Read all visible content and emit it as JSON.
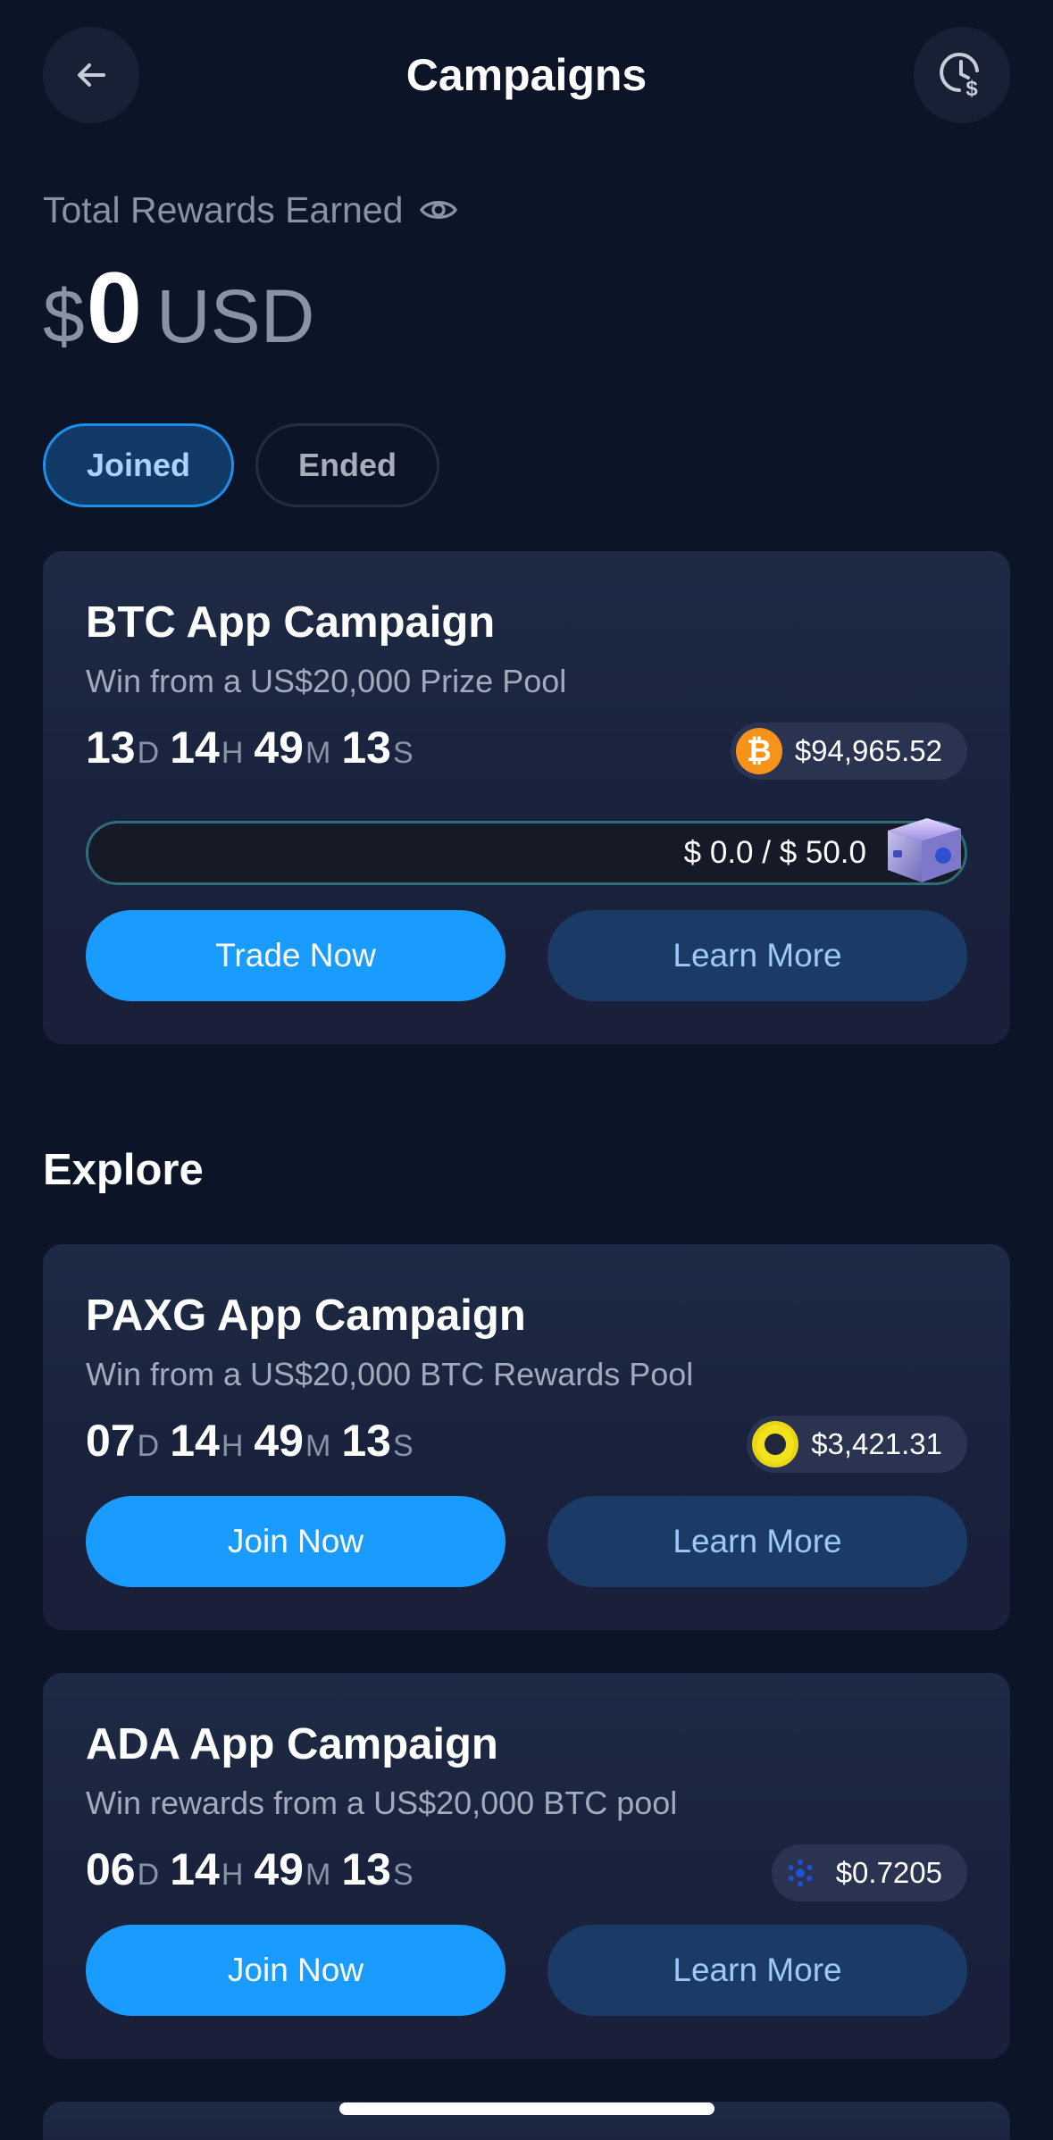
{
  "header": {
    "title": "Campaigns",
    "back_icon": "arrow-left-icon",
    "history_icon": "clock-dollar-icon"
  },
  "rewards": {
    "label": "Total Rewards Earned",
    "currency_symbol": "$",
    "amount": "0",
    "unit": "USD",
    "visibility_icon": "eye-icon"
  },
  "tabs": [
    {
      "label": "Joined",
      "active": true
    },
    {
      "label": "Ended",
      "active": false
    }
  ],
  "joined_campaign": {
    "title": "BTC App Campaign",
    "subtitle": "Win from a US$20,000 Prize Pool",
    "countdown": {
      "days": "13",
      "d": "D",
      "hours": "14",
      "h": "H",
      "minutes": "49",
      "m": "M",
      "seconds": "13",
      "s": "S"
    },
    "coin_icon": "bitcoin-icon",
    "coin_glyph": "₿",
    "price": "$94,965.52",
    "progress_text": "$ 0.0 / $ 50.0",
    "progress_value": 0.0,
    "progress_target": 50.0,
    "primary_label": "Trade Now",
    "secondary_label": "Learn More"
  },
  "explore": {
    "title": "Explore",
    "campaigns": [
      {
        "title": "PAXG App Campaign",
        "subtitle": "Win from a US$20,000 BTC Rewards Pool",
        "countdown": {
          "days": "07",
          "d": "D",
          "hours": "14",
          "h": "H",
          "minutes": "49",
          "m": "M",
          "seconds": "13",
          "s": "S"
        },
        "coin_icon": "paxg-icon",
        "price": "$3,421.31",
        "primary_label": "Join Now",
        "secondary_label": "Learn More"
      },
      {
        "title": "ADA App Campaign",
        "subtitle": "Win rewards from a US$20,000 BTC pool",
        "countdown": {
          "days": "06",
          "d": "D",
          "hours": "14",
          "h": "H",
          "minutes": "49",
          "m": "M",
          "seconds": "13",
          "s": "S"
        },
        "coin_icon": "cardano-icon",
        "price": "$0.7205",
        "primary_label": "Join Now",
        "secondary_label": "Learn More"
      }
    ]
  },
  "colors": {
    "background": "#0c1428",
    "accent": "#1a9bff",
    "secondary_button": "#1b3a66",
    "btc": "#f7931a",
    "paxg": "#e8d515",
    "ada": "#1f4fd6"
  }
}
